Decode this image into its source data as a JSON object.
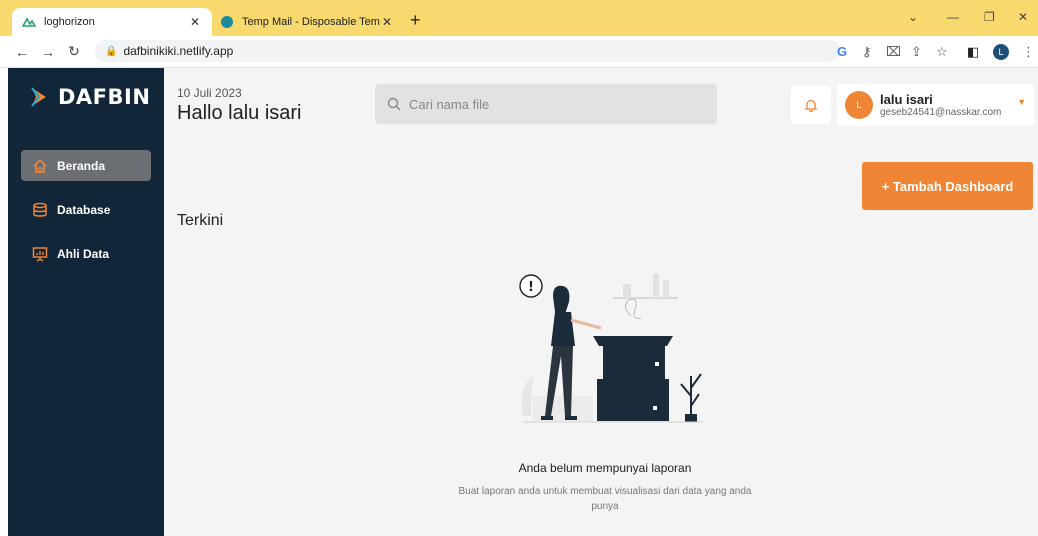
{
  "browser": {
    "tabs": [
      {
        "title": "loghorizon",
        "active": true
      },
      {
        "title": "Temp Mail - Disposable Tempora",
        "active": false
      }
    ],
    "url": "dafbinikiki.netlify.app",
    "profile_initial": "L"
  },
  "sidebar": {
    "brand": "DAFBIN",
    "items": [
      {
        "label": "Beranda",
        "active": true,
        "icon": "home-icon"
      },
      {
        "label": "Database",
        "active": false,
        "icon": "database-icon"
      },
      {
        "label": "Ahli Data",
        "active": false,
        "icon": "presentation-icon"
      }
    ]
  },
  "header": {
    "date": "10 Juli 2023",
    "greeting": "Hallo lalu isari",
    "search_placeholder": "Cari nama file"
  },
  "user": {
    "initial": "L",
    "name": "lalu isari",
    "email": "geseb24541@nasskar.com"
  },
  "actions": {
    "add_dashboard": "+ Tambah Dashboard"
  },
  "main": {
    "section_title": "Terkini",
    "empty_title": "Anda belum mempunyai laporan",
    "empty_desc": "Buat laporan anda untuk membuat visualisasi dari data yang anda punya"
  },
  "colors": {
    "sidebar_bg": "#112638",
    "accent": "#f08535",
    "tabstrip": "#f7d96d"
  }
}
